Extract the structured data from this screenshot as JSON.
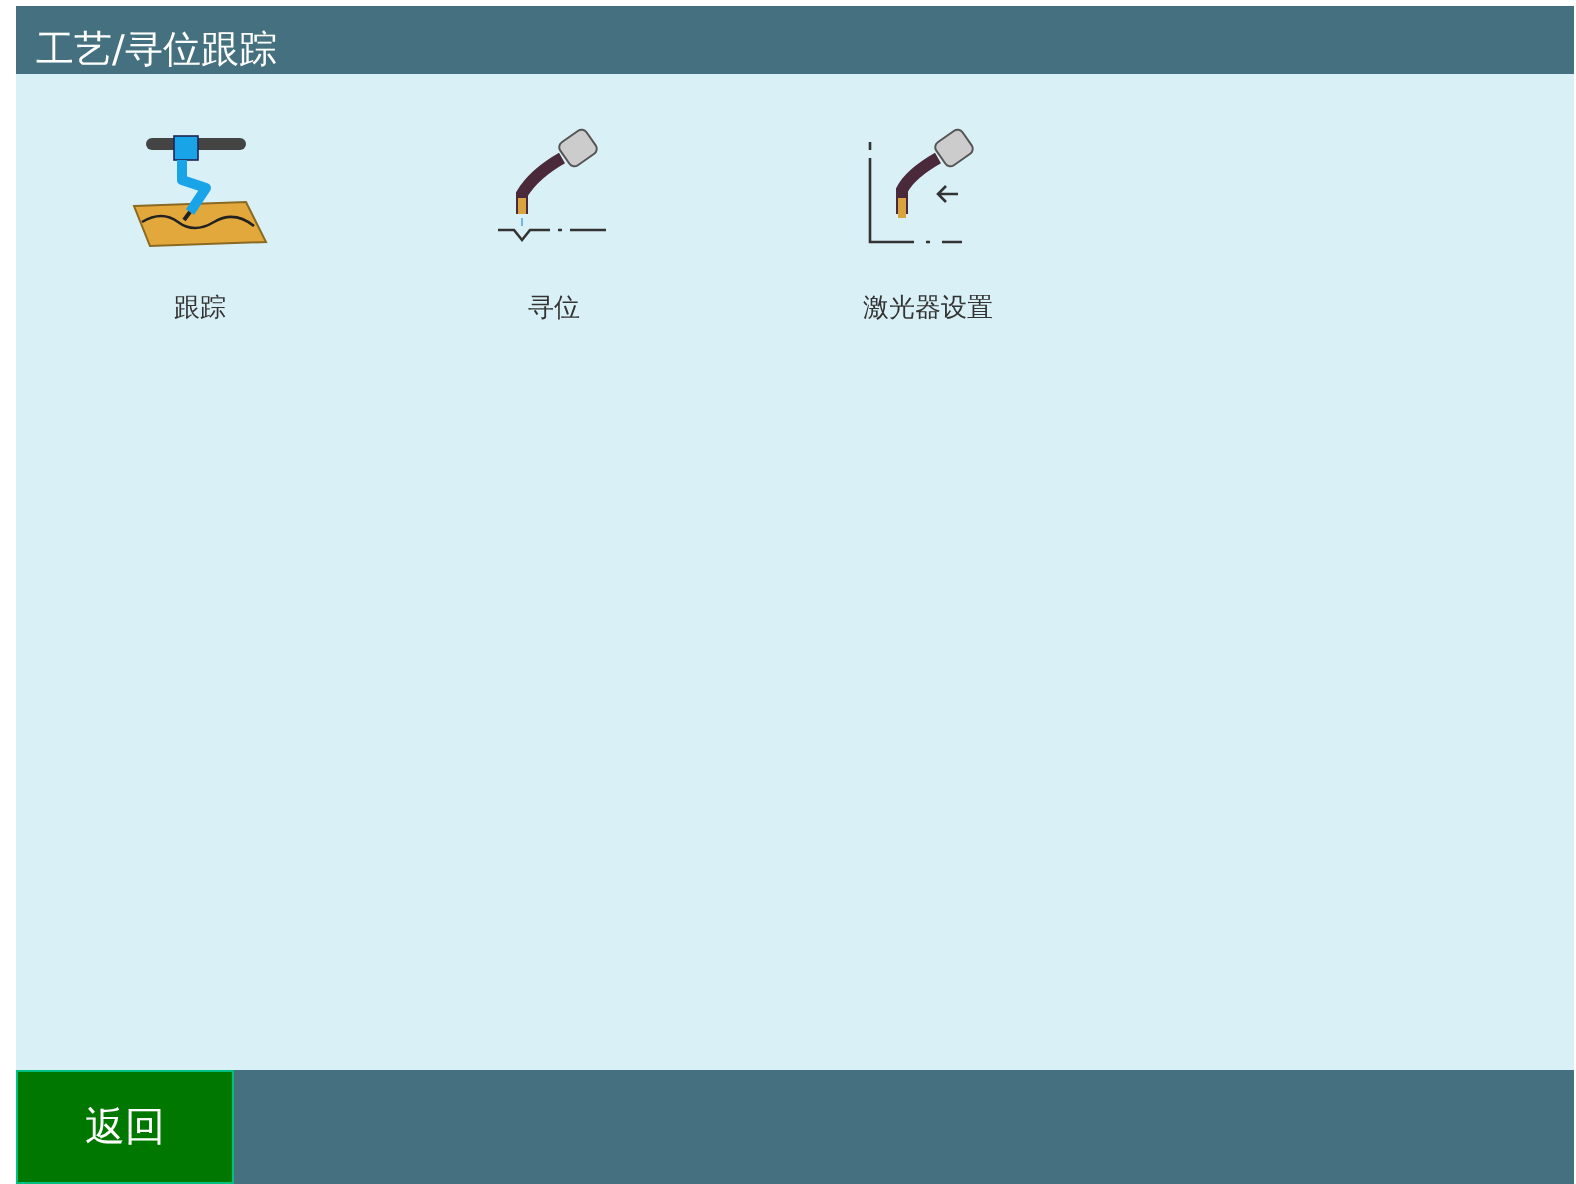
{
  "window": {
    "title": "工艺/寻位跟踪"
  },
  "items": [
    {
      "kind": "tracking",
      "label": "跟踪"
    },
    {
      "kind": "locating",
      "label": "寻位"
    },
    {
      "kind": "laser",
      "label": "激光器设置"
    }
  ],
  "buttons": [
    "返回"
  ]
}
